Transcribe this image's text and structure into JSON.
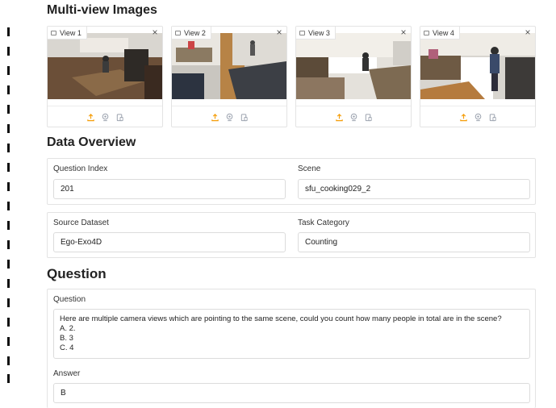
{
  "sections": {
    "multiview_title": "Multi-view Images",
    "overview_title": "Data Overview",
    "question_title": "Question"
  },
  "views": [
    {
      "label": "View 1"
    },
    {
      "label": "View 2"
    },
    {
      "label": "View 3"
    },
    {
      "label": "View 4"
    }
  ],
  "overview": {
    "question_index_label": "Question Index",
    "question_index_value": "201",
    "scene_label": "Scene",
    "scene_value": "sfu_cooking029_2",
    "source_dataset_label": "Source Dataset",
    "source_dataset_value": "Ego-Exo4D",
    "task_category_label": "Task Category",
    "task_category_value": "Counting"
  },
  "question": {
    "question_label": "Question",
    "question_lines": [
      "Here are multiple camera views which are pointing to the same scene, could you count how many people in total are in the scene?",
      "A. 2.",
      "B. 3",
      "C. 4"
    ],
    "answer_label": "Answer",
    "answer_value": "B"
  },
  "colors": {
    "toolbar_accent": "#f59e0b",
    "toolbar_muted": "#9ca3af",
    "border": "#e3e3e3"
  },
  "icons": {
    "view_label": "image-icon",
    "view_close": "close-icon",
    "toolbar": [
      "upload-icon",
      "webcam-icon",
      "clipboard-icon"
    ]
  }
}
